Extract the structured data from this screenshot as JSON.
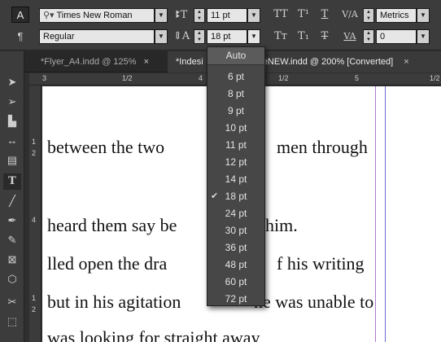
{
  "control_bar": {
    "font_family": "Times New Roman",
    "font_style": "Regular",
    "font_size": "11 pt",
    "leading": "18 pt",
    "kerning": "Metrics",
    "tracking": "0",
    "icons": [
      "text-mode-icon",
      "paragraph-mode-icon",
      "font-search-icon",
      "font-size-icon",
      "leading-icon",
      "all-caps-icon",
      "superscript-icon",
      "underline-icon",
      "small-caps-icon",
      "subscript-icon",
      "strikethrough-icon",
      "kerning-icon",
      "tracking-icon"
    ],
    "mode_char_label": "A",
    "mode_para_label": "¶"
  },
  "tabs": [
    {
      "label": "*Flyer_A4.indd @ 125%",
      "close": "×",
      "active": false
    },
    {
      "label": "*Indesi",
      "active": true
    },
    {
      "label": "ateNEW.indd @ 200% [Converted]",
      "close": "×",
      "active": true
    }
  ],
  "ruler": {
    "h_labels": [
      "3",
      "1/2",
      "4",
      "1/2",
      "5",
      "1/2"
    ],
    "v_labels": [
      "1",
      "2",
      "4",
      "1",
      "2"
    ]
  },
  "document": {
    "lines": [
      "between the two",
      "men through",
      "heard them say be",
      "him.",
      "lled open the dra",
      "f his writing",
      "but in his agitation",
      "he was unable to",
      "was looking for straight away"
    ]
  },
  "leading_menu": {
    "items": [
      "Auto",
      "6 pt",
      "8 pt",
      "9 pt",
      "10 pt",
      "11 pt",
      "12 pt",
      "14 pt",
      "18 pt",
      "24 pt",
      "30 pt",
      "36 pt",
      "48 pt",
      "60 pt",
      "72 pt"
    ],
    "selected": "18 pt",
    "check_glyph": "✔"
  },
  "colors": {
    "accent": "#6c6cd0",
    "menu_bg": "#474747",
    "page": "#ffffff"
  }
}
